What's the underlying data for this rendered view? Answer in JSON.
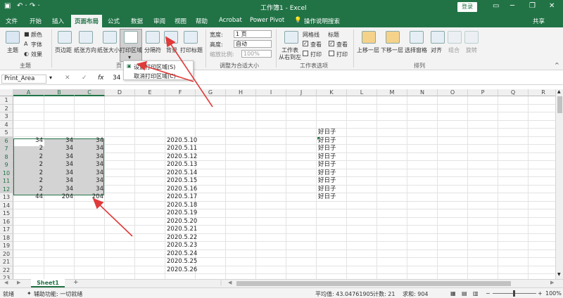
{
  "window": {
    "title": "工作簿1 - Excel",
    "login_label": "登录",
    "minimize": "─",
    "restore": "❐",
    "close": "✕",
    "autosave": "↶ · ↷ ·"
  },
  "tabs": [
    "文件",
    "开始",
    "插入",
    "页面布局",
    "公式",
    "数据",
    "审阅",
    "视图",
    "帮助",
    "Acrobat",
    "Power Pivot"
  ],
  "active_tab": "页面布局",
  "tell_me": "操作说明搜索",
  "share": "共享",
  "ribbon": {
    "theme": {
      "theme_btn": "主题",
      "colors": "颜色",
      "fonts": "字体",
      "effects": "效果",
      "group": "主题"
    },
    "page_setup": {
      "margins": "页边距",
      "orientation": "纸张方向",
      "size": "纸张大小",
      "print_area": "打印区域",
      "breaks": "分隔符",
      "background": "背景",
      "print_titles": "打印标题",
      "group": "页"
    },
    "scale": {
      "width_label": "宽度:",
      "width_val": "1 页",
      "height_label": "高度:",
      "height_val": "自动",
      "scale_label": "缩放比例:",
      "scale_val": "100%",
      "group": "调整为合适大小"
    },
    "sheet_options": {
      "gridlines": "网格线",
      "headings": "标题",
      "view": "查看",
      "print": "打印",
      "group": "工作表选项",
      "rtl": "工作表从右到左"
    },
    "arrange": {
      "forward": "上移一层",
      "backward": "下移一层",
      "selection_pane": "选择窗格",
      "align": "对齐",
      "group_btn": "组合",
      "rotate": "旋转",
      "group": "排列"
    }
  },
  "menu": {
    "set_print_area": "设置打印区域(S)",
    "clear_print_area": "取消打印区域(C)"
  },
  "formula_bar": {
    "name_box": "Print_Area",
    "cancel": "✕",
    "enter": "✓",
    "fx": "fx",
    "value": "34"
  },
  "columns": [
    "A",
    "B",
    "C",
    "D",
    "E",
    "F",
    "G",
    "H",
    "I",
    "J",
    "K",
    "L",
    "M",
    "N",
    "O",
    "P",
    "Q",
    "R"
  ],
  "rows": [
    "1",
    "2",
    "3",
    "4",
    "5",
    "6",
    "7",
    "8",
    "9",
    "10",
    "11",
    "12",
    "13",
    "14",
    "15",
    "16",
    "17",
    "18",
    "19",
    "20",
    "21",
    "22",
    "23",
    "24",
    "25",
    "26"
  ],
  "table_abc": [
    [
      "34",
      "34",
      "34"
    ],
    [
      "2",
      "34",
      "34"
    ],
    [
      "2",
      "34",
      "34"
    ],
    [
      "2",
      "34",
      "34"
    ],
    [
      "2",
      "34",
      "34"
    ],
    [
      "2",
      "34",
      "34"
    ],
    [
      "2",
      "34",
      "34"
    ],
    [
      "44",
      "204",
      "204"
    ]
  ],
  "col_f_dates": [
    "2020.5.10",
    "2020.5.11",
    "2020.5.12",
    "2020.5.13",
    "2020.5.14",
    "2020.5.15",
    "2020.5.16",
    "2020.5.17",
    "2020.5.18",
    "2020.5.19",
    "2020.5.20",
    "2020.5.21",
    "2020.5.22",
    "2020.5.23",
    "2020.5.24",
    "2020.5.25",
    "2020.5.26"
  ],
  "col_k": [
    "好日子",
    "好日子",
    "好日子",
    "好日子",
    "好日子",
    "好日子",
    "好日子",
    "好日子",
    "好日子"
  ],
  "sheet_tab": "Sheet1",
  "add_sheet": "+",
  "status": {
    "ready": "就绪",
    "accessibility": "辅助功能: 一切就绪",
    "average": "平均值: 43.04761905",
    "count": "计数: 21",
    "sum": "求和: 904",
    "zoom": "100%"
  },
  "colors": {
    "excel_green": "#217346",
    "arrow": "#e03a3a",
    "selection": "#d3d3d3"
  }
}
